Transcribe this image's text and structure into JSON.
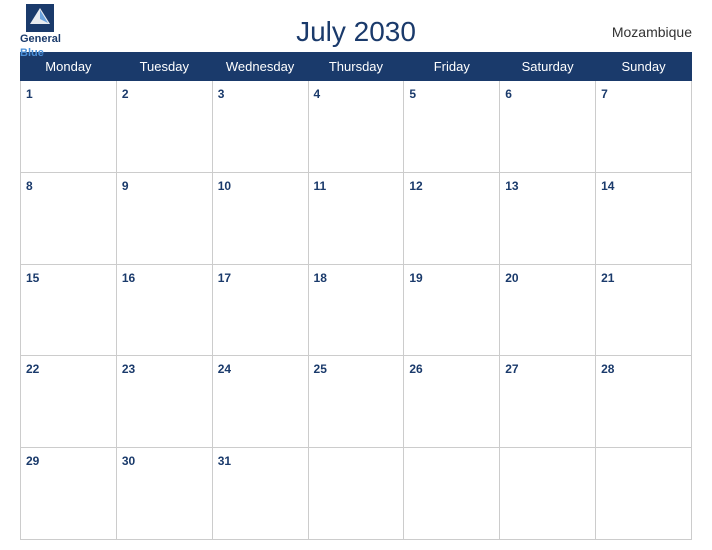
{
  "header": {
    "title": "July 2030",
    "country": "Mozambique",
    "logo_line1": "General",
    "logo_line2": "Blue"
  },
  "days_of_week": [
    "Monday",
    "Tuesday",
    "Wednesday",
    "Thursday",
    "Friday",
    "Saturday",
    "Sunday"
  ],
  "weeks": [
    [
      {
        "day": 1,
        "empty": false
      },
      {
        "day": 2,
        "empty": false
      },
      {
        "day": 3,
        "empty": false
      },
      {
        "day": 4,
        "empty": false
      },
      {
        "day": 5,
        "empty": false
      },
      {
        "day": 6,
        "empty": false
      },
      {
        "day": 7,
        "empty": false
      }
    ],
    [
      {
        "day": 8,
        "empty": false
      },
      {
        "day": 9,
        "empty": false
      },
      {
        "day": 10,
        "empty": false
      },
      {
        "day": 11,
        "empty": false
      },
      {
        "day": 12,
        "empty": false
      },
      {
        "day": 13,
        "empty": false
      },
      {
        "day": 14,
        "empty": false
      }
    ],
    [
      {
        "day": 15,
        "empty": false
      },
      {
        "day": 16,
        "empty": false
      },
      {
        "day": 17,
        "empty": false
      },
      {
        "day": 18,
        "empty": false
      },
      {
        "day": 19,
        "empty": false
      },
      {
        "day": 20,
        "empty": false
      },
      {
        "day": 21,
        "empty": false
      }
    ],
    [
      {
        "day": 22,
        "empty": false
      },
      {
        "day": 23,
        "empty": false
      },
      {
        "day": 24,
        "empty": false
      },
      {
        "day": 25,
        "empty": false
      },
      {
        "day": 26,
        "empty": false
      },
      {
        "day": 27,
        "empty": false
      },
      {
        "day": 28,
        "empty": false
      }
    ],
    [
      {
        "day": 29,
        "empty": false
      },
      {
        "day": 30,
        "empty": false
      },
      {
        "day": 31,
        "empty": false
      },
      {
        "day": null,
        "empty": true
      },
      {
        "day": null,
        "empty": true
      },
      {
        "day": null,
        "empty": true
      },
      {
        "day": null,
        "empty": true
      }
    ]
  ]
}
